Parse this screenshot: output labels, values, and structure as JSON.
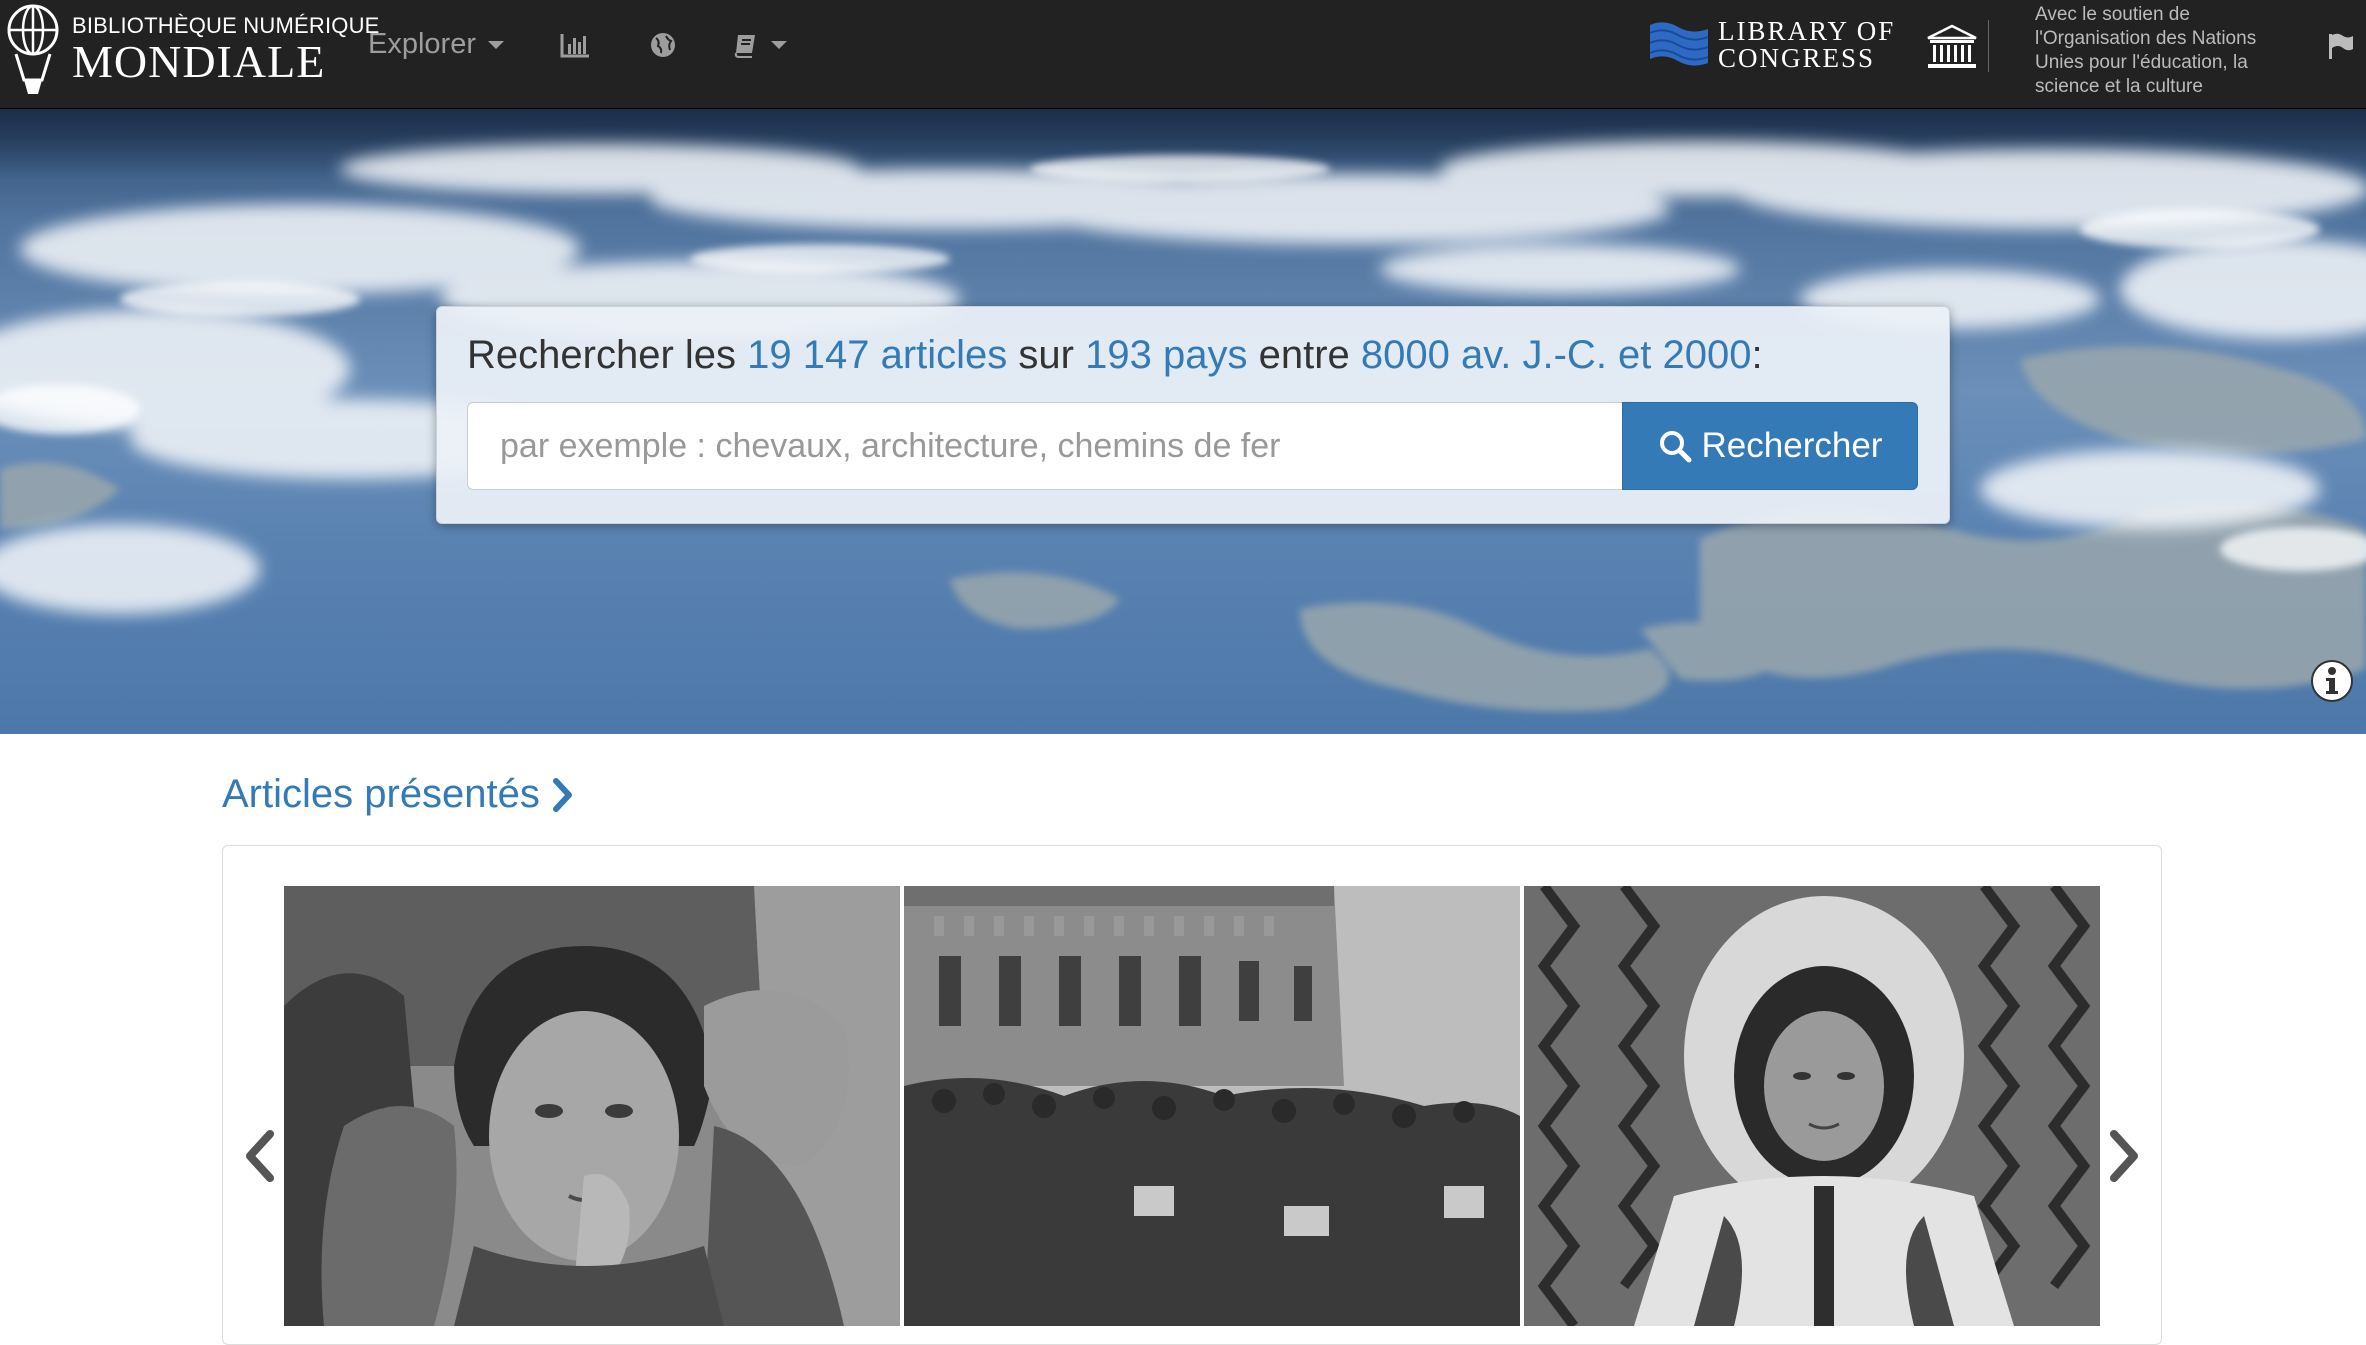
{
  "navbar": {
    "brand_small": "BIBLIOTHÈQUE NUMÉRIQUE",
    "brand_big": "MONDIALE",
    "explorer_label": "Explorer",
    "icons": [
      "bar-chart-icon",
      "globe-icon",
      "book-icon"
    ],
    "loc_line1": "LIBRARY OF",
    "loc_line2": "CONGRESS",
    "support_text": "Avec le soutien de l'Organisation des Nations Unies pour l'éducation, la science et la culture"
  },
  "search": {
    "prefix": "Rechercher les",
    "articles": "19 147 articles",
    "sur": "sur",
    "pays": "193 pays",
    "entre": "entre",
    "dates": "8000 av. J.-C. et 2000",
    "colon": ":",
    "placeholder": "par exemple : chevaux, architecture, chemins de fer",
    "button_label": "Rechercher"
  },
  "featured": {
    "title": "Articles présentés",
    "items": [
      {
        "image": "photo-migrant-mother"
      },
      {
        "image": "photo-crowd-building"
      },
      {
        "image": "photo-girl-fur-parka"
      }
    ]
  },
  "colors": {
    "navbar": "#222222",
    "accent": "#337ab7",
    "heading": "#333333"
  }
}
